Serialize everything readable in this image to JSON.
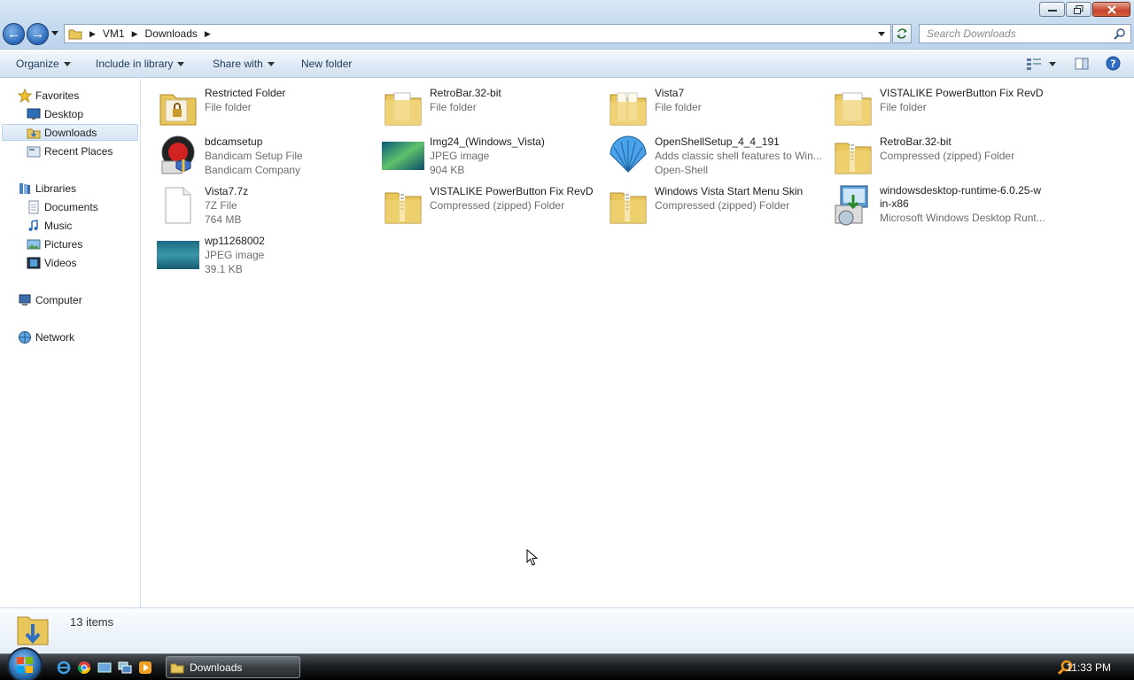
{
  "window": {
    "breadcrumb": [
      "VM1",
      "Downloads"
    ],
    "search_placeholder": "Search Downloads"
  },
  "toolbar": {
    "organize": "Organize",
    "include": "Include in library",
    "share": "Share with",
    "new_folder": "New folder"
  },
  "nav": {
    "favorites": "Favorites",
    "desktop": "Desktop",
    "downloads": "Downloads",
    "recent": "Recent Places",
    "libraries": "Libraries",
    "documents": "Documents",
    "music": "Music",
    "pictures": "Pictures",
    "videos": "Videos",
    "computer": "Computer",
    "network": "Network"
  },
  "files": [
    {
      "name": "Restricted Folder",
      "l1": "File folder",
      "l2": "",
      "icon": "folder-lock-icon"
    },
    {
      "name": "RetroBar.32-bit",
      "l1": "File folder",
      "l2": "",
      "icon": "folder-icon"
    },
    {
      "name": "Vista7",
      "l1": "File folder",
      "l2": "",
      "icon": "folder-icon"
    },
    {
      "name": "VISTALIKE PowerButton Fix RevD",
      "l1": "File folder",
      "l2": "",
      "icon": "folder-icon"
    },
    {
      "name": "bdcamsetup",
      "l1": "Bandicam Setup File",
      "l2": "Bandicam Company",
      "icon": "bandicam-icon"
    },
    {
      "name": "Img24_(Windows_Vista)",
      "l1": "JPEG image",
      "l2": "904 KB",
      "icon": "image-thumbnail-icon"
    },
    {
      "name": "OpenShellSetup_4_4_191",
      "l1": "Adds classic shell features to Win...",
      "l2": "Open-Shell",
      "icon": "shell-icon"
    },
    {
      "name": "RetroBar.32-bit",
      "l1": "Compressed (zipped) Folder",
      "l2": "",
      "icon": "zip-folder-icon"
    },
    {
      "name": "Vista7.7z",
      "l1": "7Z File",
      "l2": "764 MB",
      "icon": "blank-file-icon"
    },
    {
      "name": "VISTALIKE PowerButton Fix RevD",
      "l1": "Compressed (zipped) Folder",
      "l2": "",
      "icon": "zip-folder-icon"
    },
    {
      "name": "Windows Vista Start Menu Skin",
      "l1": "Compressed (zipped) Folder",
      "l2": "",
      "icon": "zip-folder-icon"
    },
    {
      "name": "windowsdesktop-runtime-6.0.25-w\nin-x86",
      "l1": "Microsoft Windows Desktop Runt...",
      "l2": "",
      "icon": "installer-icon"
    },
    {
      "name": "wp11268002",
      "l1": "JPEG image",
      "l2": "39.1 KB",
      "icon": "image-thumbnail-icon"
    }
  ],
  "status": {
    "count": "13 items"
  },
  "taskbar": {
    "task": "Downloads",
    "clock": "11:33 PM"
  },
  "colors": {
    "folder": "#e8c65a",
    "accent": "#2a67b7"
  }
}
